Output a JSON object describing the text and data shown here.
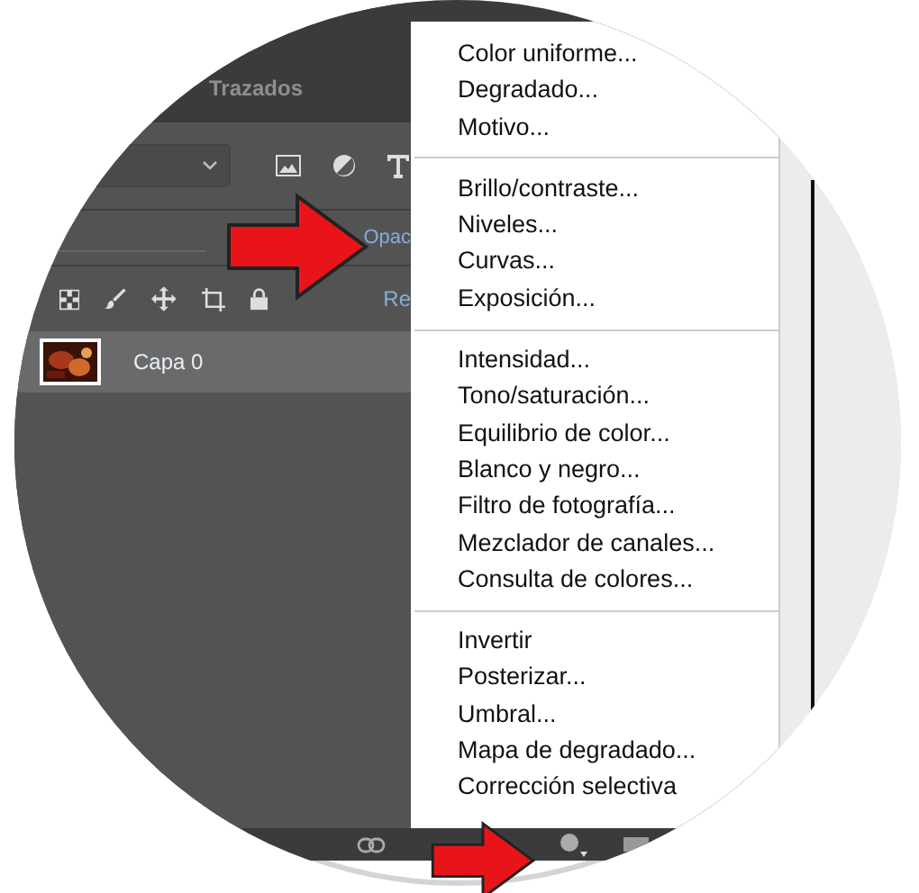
{
  "panel": {
    "tab": "Trazados",
    "opacity_label": "Opac",
    "lock_label": "Re",
    "layers": [
      {
        "name": "Capa 0"
      }
    ]
  },
  "menu": {
    "groups": [
      {
        "items": [
          "Color uniforme...",
          "Degradado...",
          "Motivo..."
        ]
      },
      {
        "items": [
          "Brillo/contraste...",
          "Niveles...",
          "Curvas...",
          "Exposición..."
        ]
      },
      {
        "items": [
          "Intensidad...",
          "Tono/saturación...",
          "Equilibrio de color...",
          "Blanco y negro...",
          "Filtro de fotografía...",
          "Mezclador de canales...",
          "Consulta de colores..."
        ]
      },
      {
        "items": [
          "Invertir",
          "Posterizar...",
          "Umbral...",
          "Mapa de degradado...",
          "Corrección selectiva"
        ]
      }
    ]
  }
}
